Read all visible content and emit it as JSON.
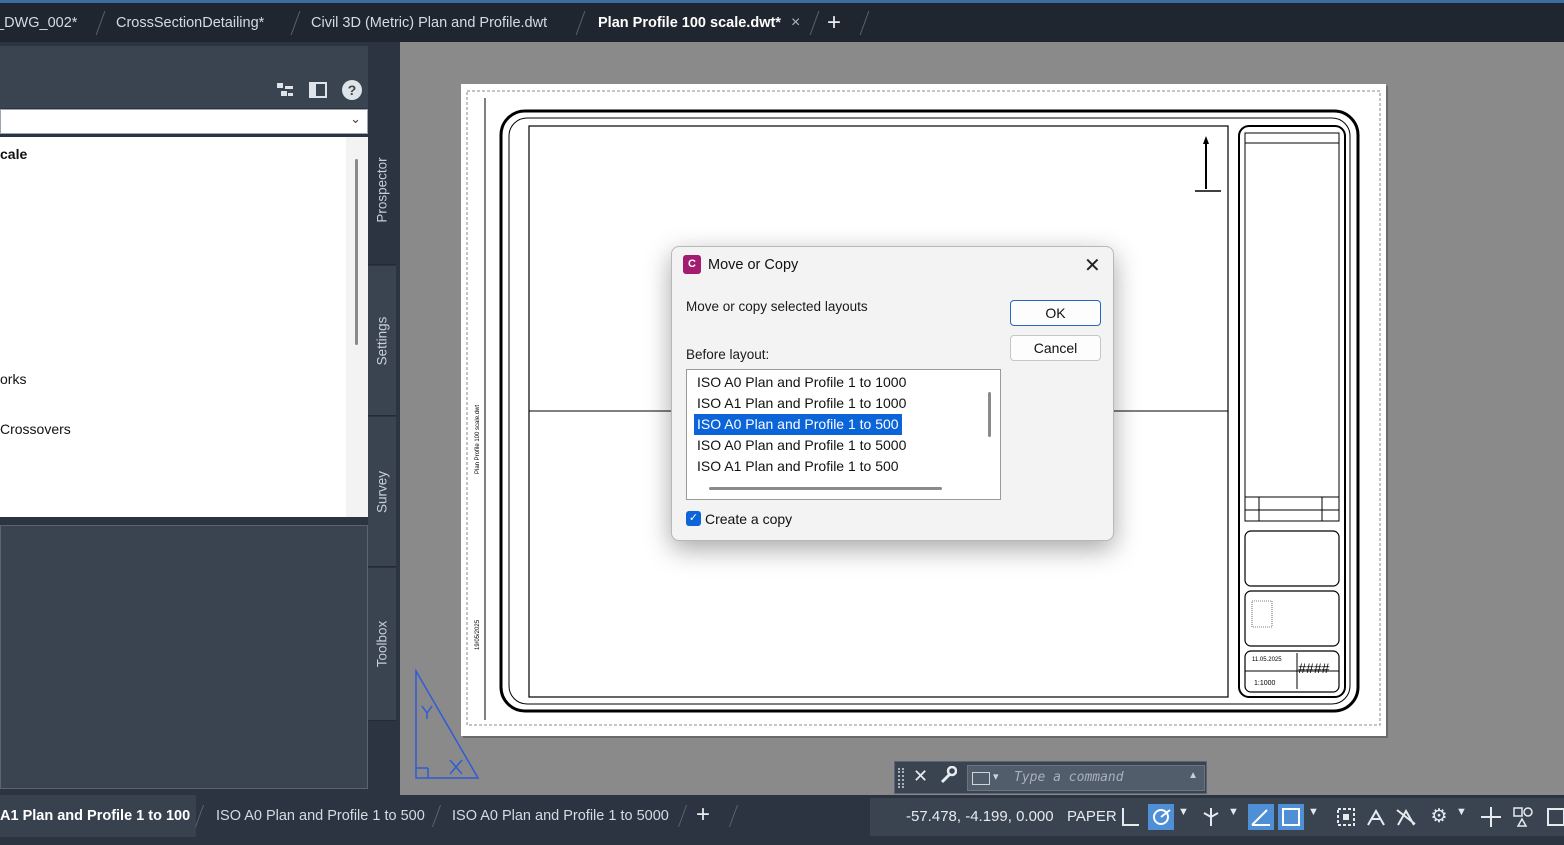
{
  "file_tabs": [
    {
      "label": "_DWG_002*"
    },
    {
      "label": "CrossSectionDetailing*"
    },
    {
      "label": "Civil 3D (Metric) Plan and Profile.dwt"
    },
    {
      "label": "Plan Profile 100 scale.dwt*",
      "active": true
    }
  ],
  "file_tab_close": "×",
  "file_tab_add": "+",
  "panel": {
    "tree_items": [
      "cale",
      "orks",
      "Crossovers"
    ],
    "vertical_tabs": [
      "Prospector",
      "Settings",
      "Survey",
      "Toolbox"
    ],
    "help_glyph": "?"
  },
  "drawing": {
    "vertical_text_1": "Plan Profile 100 scale.dwt",
    "vertical_text_2": "19/05/2025",
    "scale_text": "1:1000",
    "date_text": "11.05.2025",
    "hash_text": "####"
  },
  "command_line": {
    "placeholder": "Type a command"
  },
  "layout_tabs": [
    {
      "label": "A1 Plan and Profile 1 to 100",
      "active": true
    },
    {
      "label": "ISO A0 Plan and Profile 1 to 500"
    },
    {
      "label": "ISO A0 Plan and Profile 1 to 5000"
    }
  ],
  "layout_tab_add": "+",
  "status_bar": {
    "coordinates": "-57.478, -4.199, 0.000",
    "space": "PAPER"
  },
  "dialog": {
    "title": "Move or Copy",
    "app_icon_letter": "C",
    "message": "Move or copy selected layouts",
    "before_label": "Before layout:",
    "ok_label": "OK",
    "cancel_label": "Cancel",
    "layouts": [
      "ISO A0 Plan and Profile 1 to 1000",
      "ISO A1 Plan and Profile 1 to 1000",
      "ISO A0 Plan and Profile 1 to 500",
      "ISO A0 Plan and Profile 1 to 5000",
      "ISO A1 Plan and Profile 1 to 500"
    ],
    "selected_index": 2,
    "create_copy_label": "Create a copy",
    "create_copy_checked": true
  },
  "colors": {
    "accent": "#0b64d8",
    "app_icon": "#a31c6f",
    "background": "#2b3440",
    "ucs": "#2f5bd8"
  }
}
